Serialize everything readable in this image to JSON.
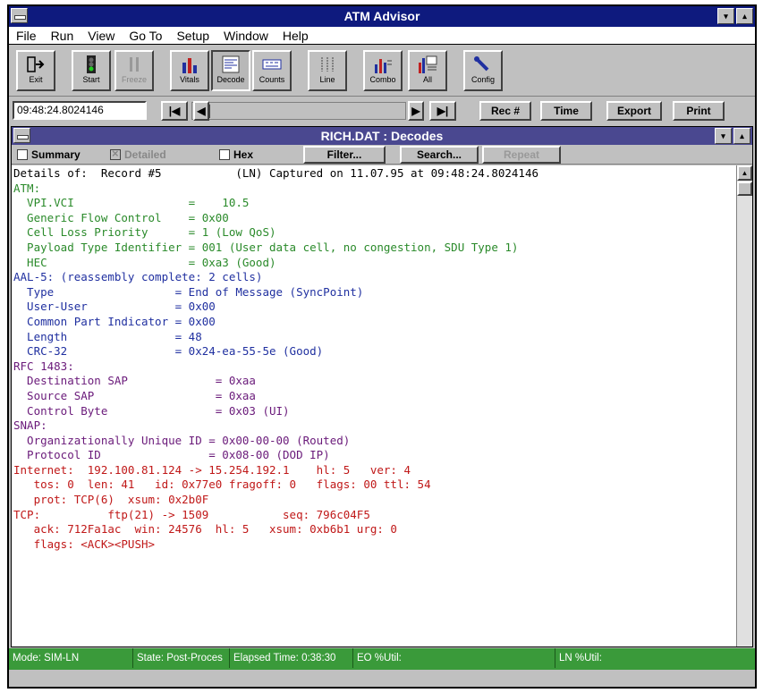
{
  "app": {
    "title": "ATM Advisor"
  },
  "titlebar": {
    "minimize_glyph": "▾",
    "maximize_glyph": "▴"
  },
  "menu": [
    "File",
    "Run",
    "View",
    "Go To",
    "Setup",
    "Window",
    "Help"
  ],
  "toolbar": [
    "Exit",
    "Start",
    "Freeze",
    "Vitals",
    "Decode",
    "Counts",
    "Line",
    "Combo",
    "All",
    "Config"
  ],
  "nav": {
    "timestamp": "09:48:24.8024146",
    "first_glyph": "|◀",
    "prev_glyph": "◀",
    "next_glyph": "▶",
    "last_glyph": "▶|",
    "rec_label": "Rec #",
    "time_label": "Time",
    "export_label": "Export",
    "print_label": "Print"
  },
  "decodes": {
    "title": "RICH.DAT : Decodes",
    "summary_label": "Summary",
    "detailed_label": "Detailed",
    "hex_label": "Hex",
    "filter_label": "Filter...",
    "search_label": "Search...",
    "repeat_label": "Repeat"
  },
  "lines": [
    "Details of:  Record #5           (LN) Captured on 11.07.95 at 09:48:24.8024146",
    "ATM:",
    "  VPI.VCI                 =    10.5",
    "  Generic Flow Control    = 0x00",
    "  Cell Loss Priority      = 1 (Low QoS)",
    "  Payload Type Identifier = 001 (User data cell, no congestion, SDU Type 1)",
    "  HEC                     = 0xa3 (Good)",
    "AAL-5: (reassembly complete: 2 cells)",
    "  Type                  = End of Message (SyncPoint)",
    "  User-User             = 0x00",
    "  Common Part Indicator = 0x00",
    "  Length                = 48",
    "  CRC-32                = 0x24-ea-55-5e (Good)",
    "RFC 1483:",
    "  Destination SAP             = 0xaa",
    "  Source SAP                  = 0xaa",
    "  Control Byte                = 0x03 (UI)",
    "SNAP:",
    "  Organizationally Unique ID = 0x00-00-00 (Routed)",
    "  Protocol ID                = 0x08-00 (DOD IP)",
    "Internet:  192.100.81.124 -> 15.254.192.1    hl: 5   ver: 4",
    "   tos: 0  len: 41   id: 0x77e0 fragoff: 0   flags: 00 ttl: 54",
    "   prot: TCP(6)  xsum: 0x2b0F",
    "TCP:          ftp(21) -> 1509           seq: 796c04F5",
    "   ack: 712Fa1ac  win: 24576  hl: 5   xsum: 0xb6b1 urg: 0",
    "   flags: <ACK><PUSH>"
  ],
  "line_colors": [
    "#000000",
    "#2a8a2a",
    "#2030a0",
    "#6a1a7a",
    "#c01818"
  ],
  "status": {
    "mode": "Mode: SIM-LN",
    "state": "State: Post-Proces",
    "elapsed": "Elapsed Time: 0:38:30",
    "eo": "EO %Util:",
    "ln": "LN %Util:"
  }
}
